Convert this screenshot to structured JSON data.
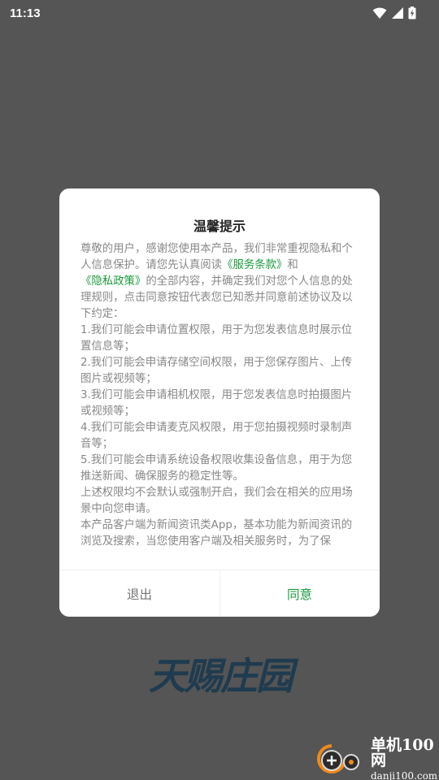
{
  "status_bar": {
    "time": "11:13",
    "icons": [
      "wifi-icon",
      "cellular-signal-icon",
      "battery-charging-icon"
    ]
  },
  "colors": {
    "backdrop": "#555555",
    "accent_green": "#1a9b3c",
    "body_text": "#888888",
    "title_text": "#222222"
  },
  "dialog": {
    "title": "温馨提示",
    "body": [
      {
        "segments": [
          {
            "text": "尊敬的用户，感谢您使用本产品，我们非常重视隐私和个人信息保护。请您先认真阅读",
            "link": false
          },
          {
            "text": "《服务条款》",
            "link": true
          },
          {
            "text": "和",
            "link": false
          },
          {
            "text": "《隐私政策》",
            "link": true
          },
          {
            "text": "的全部内容，并确定我们对您个人信息的处理规则，点击同意按钮代表您已知悉并同意前述协议及以下约定：",
            "link": false
          }
        ]
      },
      {
        "segments": [
          {
            "text": "1.我们可能会申请位置权限，用于为您发表信息时展示位置信息等；",
            "link": false
          }
        ]
      },
      {
        "segments": [
          {
            "text": "2.我们可能会申请存储空间权限，用于您保存图片、上传图片或视频等；",
            "link": false
          }
        ]
      },
      {
        "segments": [
          {
            "text": "3.我们可能会申请相机权限，用于您发表信息时拍摄图片或视频等；",
            "link": false
          }
        ]
      },
      {
        "segments": [
          {
            "text": "4.我们可能会申请麦克风权限，用于您拍摄视频时录制声音等；",
            "link": false
          }
        ]
      },
      {
        "segments": [
          {
            "text": "5.我们可能会申请系统设备权限收集设备信息，用于为您推送新闻、确保服务的稳定性等。",
            "link": false
          }
        ]
      },
      {
        "segments": [
          {
            "text": "上述权限均不会默认或强制开启，我们会在相关的应用场景中向您申请。",
            "link": false
          }
        ]
      },
      {
        "segments": [
          {
            "text": "本产品客户端为新闻资讯类App，基本功能为新闻资讯的浏览及搜索，当您使用客户端及相关服务时，为了保",
            "link": false
          }
        ]
      }
    ],
    "exit_label": "退出",
    "agree_label": "同意"
  },
  "brand_logo": {
    "text": "天赐庄园"
  },
  "watermark": {
    "name": "单机100网",
    "url": "danji100.com"
  }
}
